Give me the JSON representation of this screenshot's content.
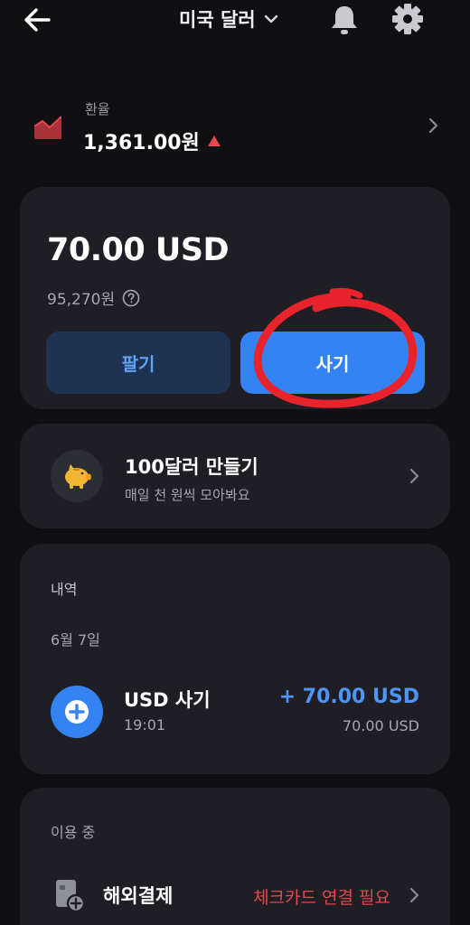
{
  "header": {
    "currency": "미국 달러"
  },
  "rate": {
    "label": "환율",
    "value": "1,361.00원",
    "trend_color": "#e4474c"
  },
  "balance": {
    "amount": "70.00 USD",
    "krw": "95,270원",
    "sell_label": "팔기",
    "buy_label": "사기"
  },
  "savings": {
    "title": "100달러 만들기",
    "subtitle": "매일 천 원씩 모아봐요"
  },
  "history": {
    "title": "내역",
    "date": "6월 7일",
    "transactions": [
      {
        "title": "USD 사기",
        "time": "19:01",
        "amount": "+ 70.00 USD",
        "balance": "70.00 USD"
      }
    ]
  },
  "in_use": {
    "title": "이용 중",
    "item_label": "해외결제",
    "item_status": "체크카드 연결 필요"
  },
  "colors": {
    "background": "#101013",
    "card": "#1e1e24",
    "accent": "#3384f2",
    "alert": "#e4474c",
    "annotation": "#e8232c"
  }
}
